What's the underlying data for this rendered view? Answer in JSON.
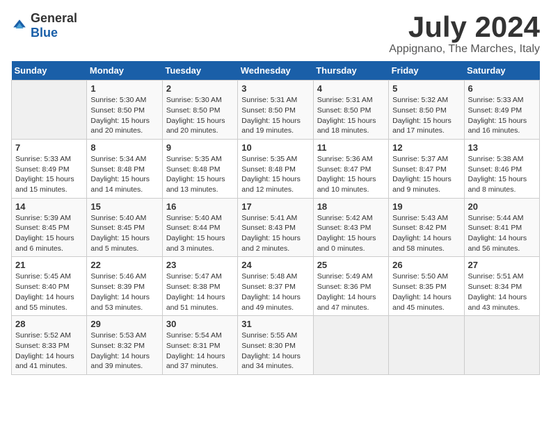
{
  "logo": {
    "general": "General",
    "blue": "Blue"
  },
  "header": {
    "month": "July 2024",
    "location": "Appignano, The Marches, Italy"
  },
  "weekdays": [
    "Sunday",
    "Monday",
    "Tuesday",
    "Wednesday",
    "Thursday",
    "Friday",
    "Saturday"
  ],
  "weeks": [
    [
      {
        "day": "",
        "sunrise": "",
        "sunset": "",
        "daylight": ""
      },
      {
        "day": "1",
        "sunrise": "Sunrise: 5:30 AM",
        "sunset": "Sunset: 8:50 PM",
        "daylight": "Daylight: 15 hours and 20 minutes."
      },
      {
        "day": "2",
        "sunrise": "Sunrise: 5:30 AM",
        "sunset": "Sunset: 8:50 PM",
        "daylight": "Daylight: 15 hours and 20 minutes."
      },
      {
        "day": "3",
        "sunrise": "Sunrise: 5:31 AM",
        "sunset": "Sunset: 8:50 PM",
        "daylight": "Daylight: 15 hours and 19 minutes."
      },
      {
        "day": "4",
        "sunrise": "Sunrise: 5:31 AM",
        "sunset": "Sunset: 8:50 PM",
        "daylight": "Daylight: 15 hours and 18 minutes."
      },
      {
        "day": "5",
        "sunrise": "Sunrise: 5:32 AM",
        "sunset": "Sunset: 8:50 PM",
        "daylight": "Daylight: 15 hours and 17 minutes."
      },
      {
        "day": "6",
        "sunrise": "Sunrise: 5:33 AM",
        "sunset": "Sunset: 8:49 PM",
        "daylight": "Daylight: 15 hours and 16 minutes."
      }
    ],
    [
      {
        "day": "7",
        "sunrise": "Sunrise: 5:33 AM",
        "sunset": "Sunset: 8:49 PM",
        "daylight": "Daylight: 15 hours and 15 minutes."
      },
      {
        "day": "8",
        "sunrise": "Sunrise: 5:34 AM",
        "sunset": "Sunset: 8:48 PM",
        "daylight": "Daylight: 15 hours and 14 minutes."
      },
      {
        "day": "9",
        "sunrise": "Sunrise: 5:35 AM",
        "sunset": "Sunset: 8:48 PM",
        "daylight": "Daylight: 15 hours and 13 minutes."
      },
      {
        "day": "10",
        "sunrise": "Sunrise: 5:35 AM",
        "sunset": "Sunset: 8:48 PM",
        "daylight": "Daylight: 15 hours and 12 minutes."
      },
      {
        "day": "11",
        "sunrise": "Sunrise: 5:36 AM",
        "sunset": "Sunset: 8:47 PM",
        "daylight": "Daylight: 15 hours and 10 minutes."
      },
      {
        "day": "12",
        "sunrise": "Sunrise: 5:37 AM",
        "sunset": "Sunset: 8:47 PM",
        "daylight": "Daylight: 15 hours and 9 minutes."
      },
      {
        "day": "13",
        "sunrise": "Sunrise: 5:38 AM",
        "sunset": "Sunset: 8:46 PM",
        "daylight": "Daylight: 15 hours and 8 minutes."
      }
    ],
    [
      {
        "day": "14",
        "sunrise": "Sunrise: 5:39 AM",
        "sunset": "Sunset: 8:45 PM",
        "daylight": "Daylight: 15 hours and 6 minutes."
      },
      {
        "day": "15",
        "sunrise": "Sunrise: 5:40 AM",
        "sunset": "Sunset: 8:45 PM",
        "daylight": "Daylight: 15 hours and 5 minutes."
      },
      {
        "day": "16",
        "sunrise": "Sunrise: 5:40 AM",
        "sunset": "Sunset: 8:44 PM",
        "daylight": "Daylight: 15 hours and 3 minutes."
      },
      {
        "day": "17",
        "sunrise": "Sunrise: 5:41 AM",
        "sunset": "Sunset: 8:43 PM",
        "daylight": "Daylight: 15 hours and 2 minutes."
      },
      {
        "day": "18",
        "sunrise": "Sunrise: 5:42 AM",
        "sunset": "Sunset: 8:43 PM",
        "daylight": "Daylight: 15 hours and 0 minutes."
      },
      {
        "day": "19",
        "sunrise": "Sunrise: 5:43 AM",
        "sunset": "Sunset: 8:42 PM",
        "daylight": "Daylight: 14 hours and 58 minutes."
      },
      {
        "day": "20",
        "sunrise": "Sunrise: 5:44 AM",
        "sunset": "Sunset: 8:41 PM",
        "daylight": "Daylight: 14 hours and 56 minutes."
      }
    ],
    [
      {
        "day": "21",
        "sunrise": "Sunrise: 5:45 AM",
        "sunset": "Sunset: 8:40 PM",
        "daylight": "Daylight: 14 hours and 55 minutes."
      },
      {
        "day": "22",
        "sunrise": "Sunrise: 5:46 AM",
        "sunset": "Sunset: 8:39 PM",
        "daylight": "Daylight: 14 hours and 53 minutes."
      },
      {
        "day": "23",
        "sunrise": "Sunrise: 5:47 AM",
        "sunset": "Sunset: 8:38 PM",
        "daylight": "Daylight: 14 hours and 51 minutes."
      },
      {
        "day": "24",
        "sunrise": "Sunrise: 5:48 AM",
        "sunset": "Sunset: 8:37 PM",
        "daylight": "Daylight: 14 hours and 49 minutes."
      },
      {
        "day": "25",
        "sunrise": "Sunrise: 5:49 AM",
        "sunset": "Sunset: 8:36 PM",
        "daylight": "Daylight: 14 hours and 47 minutes."
      },
      {
        "day": "26",
        "sunrise": "Sunrise: 5:50 AM",
        "sunset": "Sunset: 8:35 PM",
        "daylight": "Daylight: 14 hours and 45 minutes."
      },
      {
        "day": "27",
        "sunrise": "Sunrise: 5:51 AM",
        "sunset": "Sunset: 8:34 PM",
        "daylight": "Daylight: 14 hours and 43 minutes."
      }
    ],
    [
      {
        "day": "28",
        "sunrise": "Sunrise: 5:52 AM",
        "sunset": "Sunset: 8:33 PM",
        "daylight": "Daylight: 14 hours and 41 minutes."
      },
      {
        "day": "29",
        "sunrise": "Sunrise: 5:53 AM",
        "sunset": "Sunset: 8:32 PM",
        "daylight": "Daylight: 14 hours and 39 minutes."
      },
      {
        "day": "30",
        "sunrise": "Sunrise: 5:54 AM",
        "sunset": "Sunset: 8:31 PM",
        "daylight": "Daylight: 14 hours and 37 minutes."
      },
      {
        "day": "31",
        "sunrise": "Sunrise: 5:55 AM",
        "sunset": "Sunset: 8:30 PM",
        "daylight": "Daylight: 14 hours and 34 minutes."
      },
      {
        "day": "",
        "sunrise": "",
        "sunset": "",
        "daylight": ""
      },
      {
        "day": "",
        "sunrise": "",
        "sunset": "",
        "daylight": ""
      },
      {
        "day": "",
        "sunrise": "",
        "sunset": "",
        "daylight": ""
      }
    ]
  ]
}
